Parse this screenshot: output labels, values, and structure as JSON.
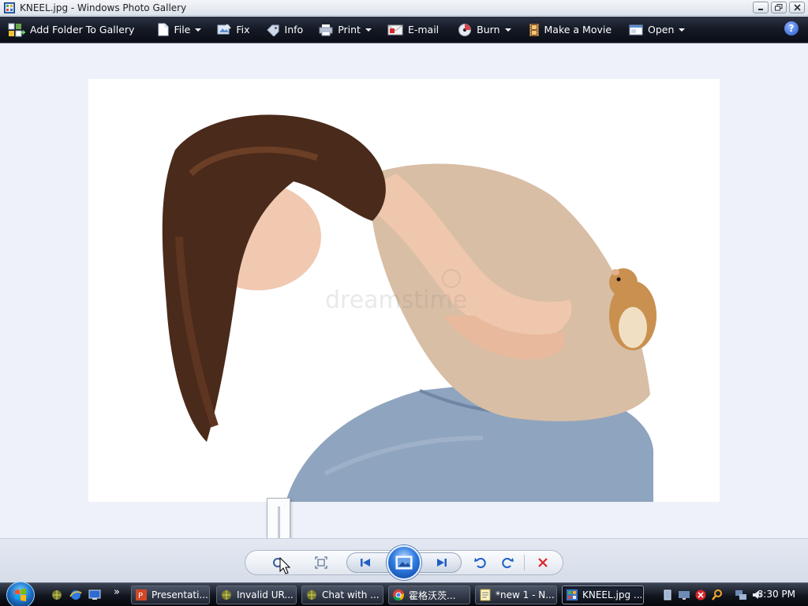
{
  "window": {
    "title": "KNEEL.jpg - Windows Photo Gallery"
  },
  "toolbar": {
    "items": [
      {
        "label": "Add Folder To Gallery",
        "icon": "add-folder-icon",
        "has_menu": false
      },
      {
        "label": "File",
        "icon": "file-icon",
        "has_menu": true
      },
      {
        "label": "Fix",
        "icon": "fix-icon",
        "has_menu": false
      },
      {
        "label": "Info",
        "icon": "info-tag-icon",
        "has_menu": false
      },
      {
        "label": "Print",
        "icon": "printer-icon",
        "has_menu": true
      },
      {
        "label": "E-mail",
        "icon": "email-icon",
        "has_menu": false
      },
      {
        "label": "Burn",
        "icon": "burn-disc-icon",
        "has_menu": true
      },
      {
        "label": "Make a Movie",
        "icon": "movie-film-icon",
        "has_menu": false
      },
      {
        "label": "Open",
        "icon": "open-window-icon",
        "has_menu": true
      }
    ],
    "help_label": "?"
  },
  "viewer": {
    "photo": {
      "description_icon": "photo-image",
      "watermark": "dreamstime"
    }
  },
  "controls": {
    "zoom_level": 0.05,
    "buttons": [
      "zoom-icon",
      "fit-window-icon",
      "previous-icon",
      "slideshow-icon",
      "next-icon",
      "rotate-counterclockwise-icon",
      "rotate-clockwise-icon",
      "delete-icon"
    ]
  },
  "taskbar": {
    "quick_launch_more": "»",
    "tasks": [
      {
        "label": "Presentati...",
        "icon": "powerpoint-icon",
        "active": false
      },
      {
        "label": "Invalid UR...",
        "icon": "browser-icon",
        "active": false
      },
      {
        "label": "Chat with ...",
        "icon": "browser-icon",
        "active": false
      },
      {
        "label": "霍格沃茨...",
        "icon": "chrome-icon",
        "active": false
      },
      {
        "label": "*new 1 - N...",
        "icon": "notepad-icon",
        "active": false
      },
      {
        "label": "KNEEL.jpg ...",
        "icon": "photo-gallery-icon",
        "active": true
      }
    ],
    "clock": "8:30 PM"
  },
  "colors": {
    "toolbar_bg": "#141925",
    "viewer_bg": "#eef1f9",
    "accent_blue": "#2f7be0",
    "delete_red": "#d9262c"
  }
}
